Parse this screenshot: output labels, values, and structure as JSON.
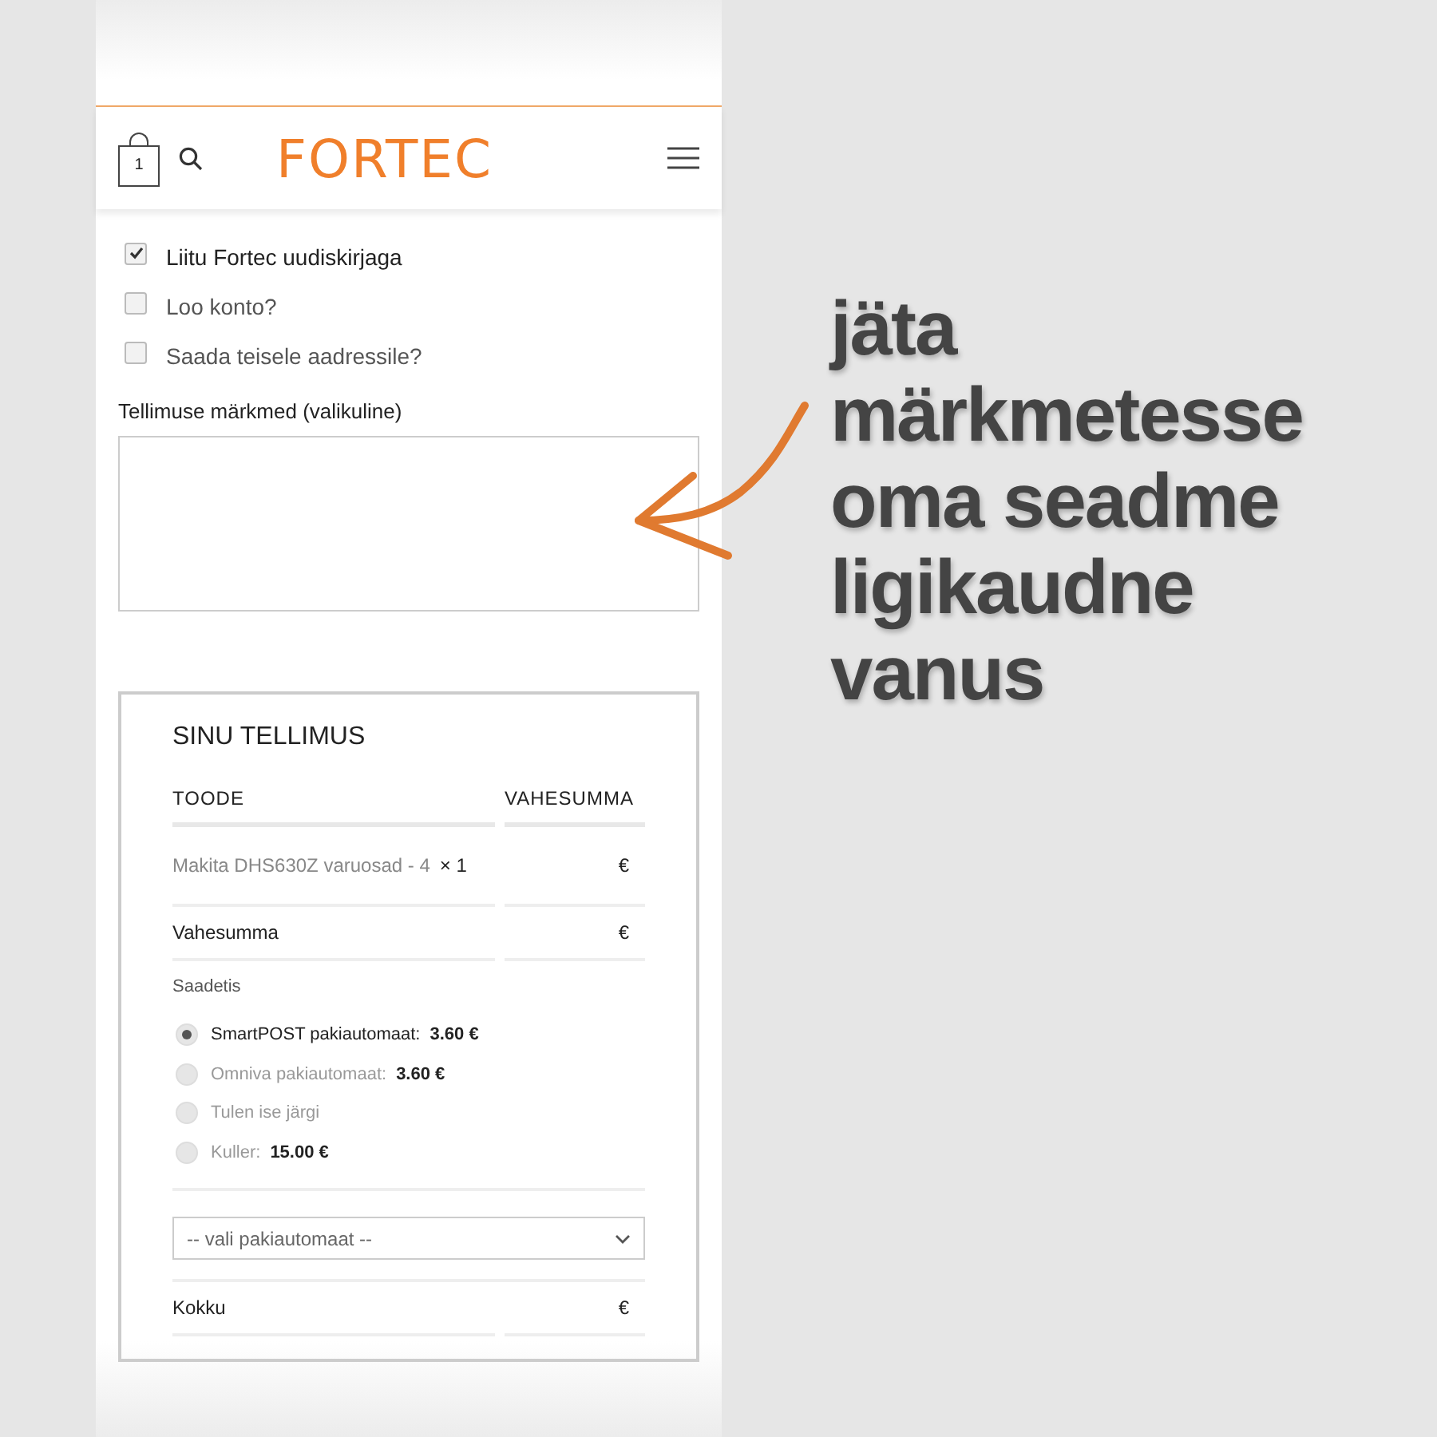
{
  "header": {
    "cart_count": "1",
    "logo": "FORTEC"
  },
  "checkboxes": [
    {
      "label": "Liitu Fortec uudiskirjaga",
      "checked": true
    },
    {
      "label": "Loo konto?",
      "checked": false
    },
    {
      "label": "Saada teisele aadressile?",
      "checked": false
    }
  ],
  "notes": {
    "label": "Tellimuse märkmed (valikuline)"
  },
  "order": {
    "title": "SINU TELLIMUS",
    "columns": [
      "TOODE",
      "VAHESUMMA"
    ],
    "item": {
      "name": "Makita DHS630Z varuosad - 4",
      "qty": "× 1",
      "total": "€"
    },
    "subtotal": {
      "label": "Vahesumma",
      "value": "€"
    },
    "shipping": {
      "label": "Saadetis",
      "options": [
        {
          "label": "SmartPOST pakiautomaat:",
          "price": "3.60 €",
          "selected": true
        },
        {
          "label": "Omniva pakiautomaat:",
          "price": "3.60 €",
          "selected": false
        },
        {
          "label": "Tulen ise järgi",
          "selected": false
        },
        {
          "label": "Kuller:",
          "price": "15.00 €",
          "selected": false
        }
      ]
    },
    "select": {
      "value": "-- vali pakiautomaat --"
    },
    "total": {
      "label": "Kokku",
      "value": "€"
    }
  },
  "callout": "jäta märkmetesse oma seadme ligikaudne vanus"
}
